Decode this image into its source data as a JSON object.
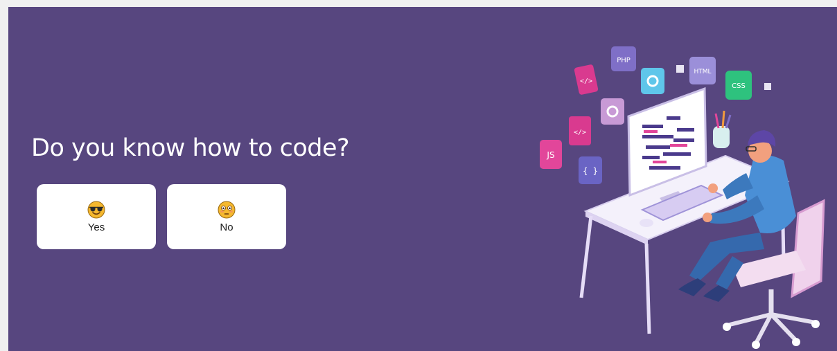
{
  "question": "Do you know how to code?",
  "options": [
    {
      "label": "Yes",
      "icon": "sunglasses-face-icon"
    },
    {
      "label": "No",
      "icon": "flushed-face-icon"
    }
  ],
  "illustration": {
    "badges": [
      "</>",
      "PHP",
      "HTML",
      "CSS",
      "</>",
      "JS",
      "{ }"
    ]
  },
  "colors": {
    "background": "#57467f",
    "card": "#ffffff",
    "emoji": "#f5b82e"
  }
}
